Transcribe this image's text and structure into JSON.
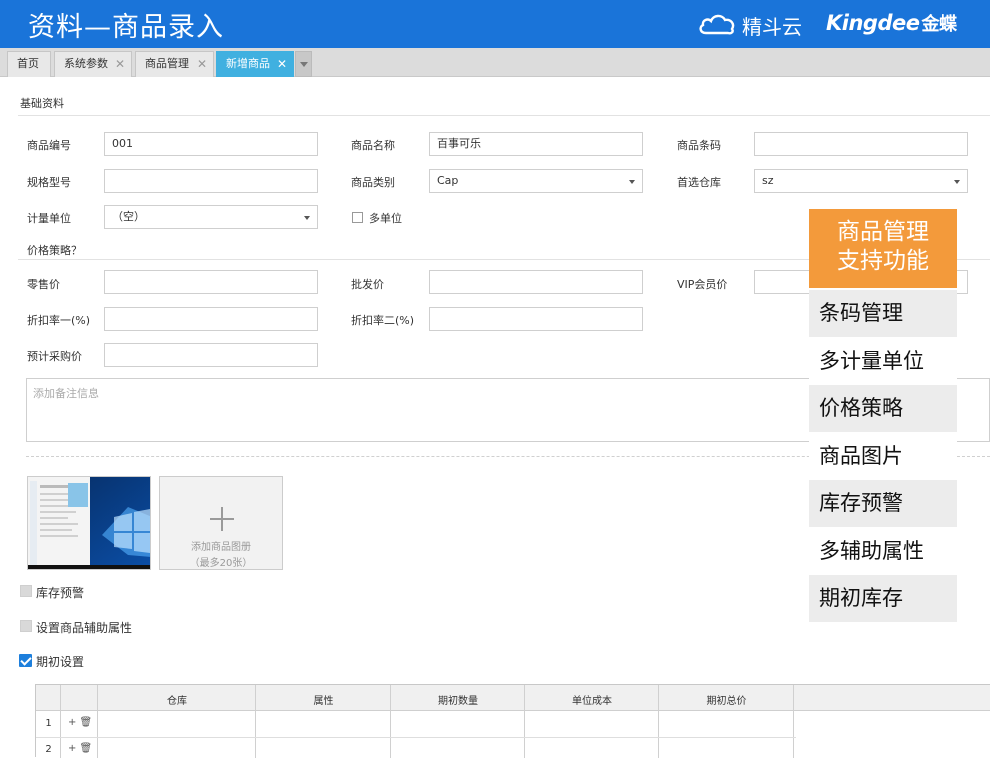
{
  "header": {
    "title": "资料—商品录入",
    "brand_jdy": "精斗云",
    "brand_kingdee": "Kingdee",
    "brand_kingdee_cn": "金蝶"
  },
  "tabs": [
    {
      "label": "首页",
      "closable": false,
      "active": false
    },
    {
      "label": "系统参数",
      "closable": true,
      "active": false
    },
    {
      "label": "商品管理",
      "closable": true,
      "active": false
    },
    {
      "label": "新增商品",
      "closable": true,
      "active": true
    }
  ],
  "tab_close_glyph": "✕",
  "colors": {
    "header": "#1a74d9",
    "active_tab": "#40b0e0",
    "panel_head": "#f39a3b",
    "checkbox_checked": "#1d7fdc"
  },
  "basic": {
    "section_title": "基础资料",
    "code_label": "商品编号",
    "code_value": "001",
    "name_label": "商品名称",
    "name_value": "百事可乐",
    "barcode_label": "商品条码",
    "barcode_value": "",
    "spec_label": "规格型号",
    "spec_value": "",
    "category_label": "商品类别",
    "category_value": "Cap",
    "warehouse_label": "首选仓库",
    "warehouse_value": "sz",
    "unit_label": "计量单位",
    "unit_value": "（空）",
    "multi_unit_label": "多单位"
  },
  "price": {
    "section_title": "价格策略？",
    "retail_label": "零售价",
    "wholesale_label": "批发价",
    "vip_label": "VIP会员价",
    "discount1_label": "折扣率一(%)",
    "discount2_label": "折扣率二(%)",
    "purchase_label": "预计采购价"
  },
  "notes_placeholder": "添加备注信息",
  "images": {
    "add_line1": "添加商品图册",
    "add_line2": "（最多20张）"
  },
  "options": {
    "stock_alert": "库存预警",
    "aux_attr": "设置商品辅助属性",
    "initial_setup": "期初设置",
    "initial_checked": true
  },
  "grid": {
    "headers": [
      "仓库",
      "属性",
      "期初数量",
      "单位成本",
      "期初总价"
    ],
    "rows": [
      "1",
      "2"
    ],
    "row_ops": "+ 🗑"
  },
  "panel": {
    "head_line1": "商品管理",
    "head_line2": "支持功能",
    "items": [
      "条码管理",
      "多计量单位",
      "价格策略",
      "商品图片",
      "库存预警",
      "多辅助属性",
      "期初库存"
    ]
  }
}
